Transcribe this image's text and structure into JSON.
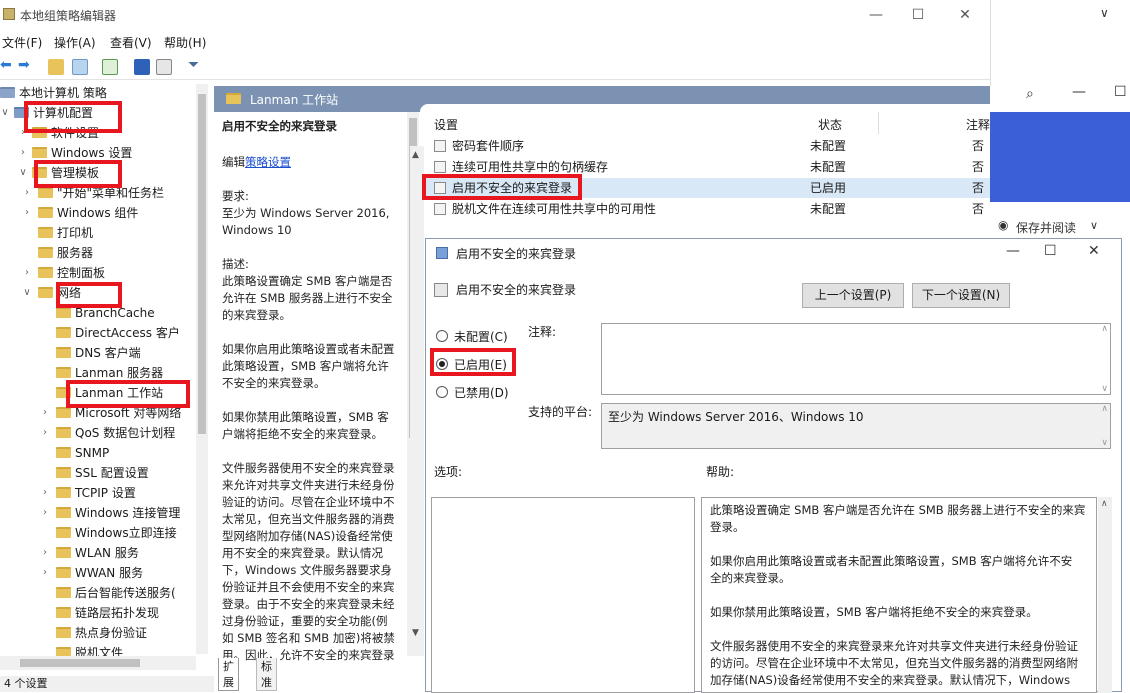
{
  "window": {
    "title": "本地组策略编辑器",
    "minimize": "—",
    "maximize": "☐",
    "close": "✕"
  },
  "menu": {
    "file": "文件(F)",
    "action": "操作(A)",
    "view": "查看(V)",
    "help": "帮助(H)"
  },
  "tree": {
    "root": "本地计算机 策略",
    "computer_config": "计算机配置",
    "software_settings": "软件设置",
    "windows_settings": "Windows 设置",
    "admin_templates": "管理模板",
    "items": [
      "\"开始\"菜单和任务栏",
      "Windows 组件",
      "打印机",
      "服务器",
      "控制面板",
      "网络",
      "BranchCache",
      "DirectAccess 客户",
      "DNS 客户端",
      "Lanman 服务器",
      "Lanman 工作站",
      "Microsoft 对等网络",
      "QoS 数据包计划程",
      "SNMP",
      "SSL 配置设置",
      "TCPIP 设置",
      "Windows 连接管理",
      "Windows立即连接",
      "WLAN 服务",
      "WWAN 服务",
      "后台智能传送服务(",
      "链路层拓扑发现",
      "热点身份验证",
      "脱机文件"
    ]
  },
  "header": {
    "title": "Lanman 工作站"
  },
  "desc": {
    "title": "启用不安全的来宾登录",
    "edit_prefix": "编辑",
    "edit_link": "策略设置",
    "req_label": "要求:",
    "req_text1": "至少为 Windows Server 2016,",
    "req_text2": "Windows 10",
    "desc_label": "描述:",
    "lines": [
      "此策略设置确定 SMB 客户端是否",
      "允许在 SMB 服务器上进行不安全",
      "的来宾登录。",
      "",
      "如果你启用此策略设置或者未配置",
      "此策略设置，SMB 客户端将允许",
      "不安全的来宾登录。",
      "",
      "如果你禁用此策略设置，SMB 客",
      "户端将拒绝不安全的来宾登录。",
      "",
      "文件服务器使用不安全的来宾登录",
      "来允许对共享文件夹进行未经身份",
      "验证的访问。尽管在企业环境中不",
      "太常见，但充当文件服务器的消费",
      "型网络附加存储(NAS)设备经常使",
      "用不安全的来宾登录。默认情况",
      "下，Windows 文件服务器要求身",
      "份验证并且不会使用不安全的来宾",
      "登录。由于不安全的来宾登录未经",
      "过身份验证，重要的安全功能(例",
      "如 SMB 签名和 SMB 加密)将被禁",
      "用。因此，允许不安全的来宾登录"
    ]
  },
  "list": {
    "col_setting": "设置",
    "col_state": "状态",
    "col_note": "注释",
    "rows": [
      {
        "name": "密码套件顺序",
        "state": "未配置",
        "note": "否"
      },
      {
        "name": "连续可用性共享中的句柄缓存",
        "state": "未配置",
        "note": "否"
      },
      {
        "name": "启用不安全的来宾登录",
        "state": "已启用",
        "note": "否"
      },
      {
        "name": "脱机文件在连续可用性共享中的可用性",
        "state": "未配置",
        "note": "否"
      }
    ]
  },
  "tabs": {
    "extended": "扩展",
    "standard": "标准"
  },
  "status": {
    "text": "4 个设置"
  },
  "side": {
    "save_read": "保存并阅读"
  },
  "dialog": {
    "title": "启用不安全的来宾登录",
    "subtitle": "启用不安全的来宾登录",
    "prev": "上一个设置(P)",
    "next": "下一个设置(N)",
    "not_configured": "未配置(C)",
    "enabled": "已启用(E)",
    "disabled": "已禁用(D)",
    "comment_label": "注释:",
    "platform_label": "支持的平台:",
    "platform_value": "至少为 Windows Server 2016、Windows 10",
    "options_label": "选项:",
    "help_label": "帮助:",
    "help_lines": [
      "此策略设置确定 SMB 客户端是否允许在 SMB 服务器上进行不安全的来宾",
      "登录。",
      "",
      "如果你启用此策略设置或者未配置此策略设置，SMB 客户端将允许不安",
      "全的来宾登录。",
      "",
      "如果你禁用此策略设置，SMB 客户端将拒绝不安全的来宾登录。",
      "",
      "文件服务器使用不安全的来宾登录来允许对共享文件夹进行未经身份验证",
      "的访问。尽管在企业环境中不太常见，但充当文件服务器的消费型网络附",
      "加存储(NAS)设备经常使用不安全的来宾登录。默认情况下，Windows"
    ]
  }
}
